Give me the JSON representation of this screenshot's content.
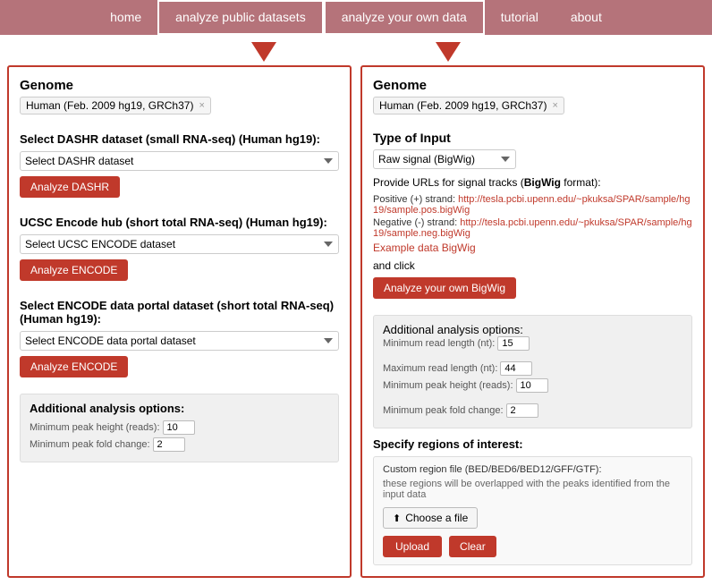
{
  "nav": {
    "items": [
      {
        "label": "home",
        "active": false
      },
      {
        "label": "analyze public datasets",
        "active": true
      },
      {
        "label": "analyze your own data",
        "active": true
      },
      {
        "label": "tutorial",
        "active": false
      },
      {
        "label": "about",
        "active": false
      }
    ]
  },
  "left_panel": {
    "genome_label": "Genome",
    "genome_value": "Human (Feb. 2009 hg19, GRCh37)",
    "dashr_section_title": "Select DASHR dataset (small RNA-seq) (Human hg19):",
    "dashr_select_placeholder": "Select DASHR dataset",
    "dashr_button": "Analyze DASHR",
    "ucsc_section_title": "UCSC Encode hub (short total RNA-seq) (Human hg19):",
    "ucsc_select_placeholder": "Select UCSC ENCODE dataset",
    "ucsc_button": "Analyze ENCODE",
    "encode_section_title": "Select ENCODE data portal dataset (short total RNA-seq) (Human hg19):",
    "encode_select_placeholder": "Select ENCODE data portal dataset",
    "encode_button": "Analyze ENCODE",
    "additional_title": "Additional analysis options:",
    "min_peak_height_label": "Minimum peak height (reads):",
    "min_peak_height_value": "10",
    "min_fold_change_label": "Minimum peak fold change:",
    "min_fold_change_value": "2"
  },
  "right_panel": {
    "genome_label": "Genome",
    "genome_value": "Human (Feb. 2009 hg19, GRCh37)",
    "type_of_input_title": "Type of Input",
    "signal_type": "Raw signal (BigWig)",
    "url_prompt": "Provide URLs for signal tracks (BigWig format):",
    "positive_strand_label": "Positive (+) strand:",
    "positive_strand_url": "http://tesla.pcbi.upenn.edu/~pkuksa/SPAR/sample/hg19/sample.pos.bigWig",
    "negative_strand_label": "Negative (-) strand:",
    "negative_strand_url": "http://tesla.pcbi.upenn.edu/~pkuksa/SPAR/sample/hg19/sample.neg.bigWig",
    "example_link": "Example data BigWig",
    "and_click": "and click",
    "analyze_button": "Analyze your own BigWig",
    "additional_title": "Additional analysis options:",
    "min_read_length_label": "Minimum read length (nt):",
    "min_read_length_value": "15",
    "max_read_length_label": "Maximum read length (nt):",
    "max_read_length_value": "44",
    "min_peak_height_label": "Minimum peak height (reads):",
    "min_peak_height_value": "10",
    "min_fold_change_label": "Minimum peak fold change:",
    "min_fold_change_value": "2",
    "regions_title": "Specify regions of interest:",
    "region_file_label": "Custom region file (BED/BED6/BED12/GFF/GTF):",
    "region_note": "these regions will be overlapped with the peaks identified from the input data",
    "choose_file_button": "Choose a file",
    "upload_button": "Upload",
    "clear_button": "Clear"
  }
}
